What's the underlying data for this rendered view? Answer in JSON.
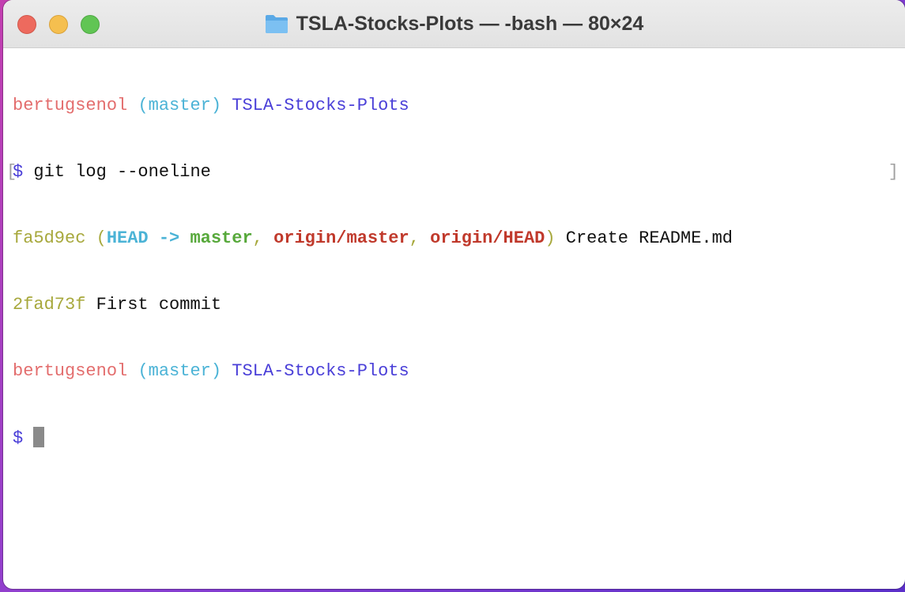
{
  "window": {
    "title": "TSLA-Stocks-Plots — -bash — 80×24",
    "icon": "folder-icon"
  },
  "terminal": {
    "lines": [
      {
        "user": "bertugsenol",
        "branch": "(master)",
        "dir": "TSLA-Stocks-Plots"
      },
      {
        "bracket": "[",
        "prompt": "$",
        "command": "git log --oneline",
        "bracket_end": "]"
      },
      {
        "hash": "fa5d9ec",
        "open": "(",
        "head": "HEAD -> master",
        "sep1": ",",
        "remote1": "origin/master",
        "sep2": ",",
        "remote2": "origin/HEAD",
        "close": ")",
        "message": "Create README.md"
      },
      {
        "hash": "2fad73f",
        "message": "First commit"
      },
      {
        "user": "bertugsenol",
        "branch": "(master)",
        "dir": "TSLA-Stocks-Plots"
      },
      {
        "prompt": "$"
      }
    ]
  },
  "colors": {
    "user": "#e36d6d",
    "branch": "#4bb3d6",
    "dir": "#4a3fd8",
    "hash": "#a7a83c",
    "local_branch": "#56a83a",
    "remote_branch": "#c0392b"
  }
}
